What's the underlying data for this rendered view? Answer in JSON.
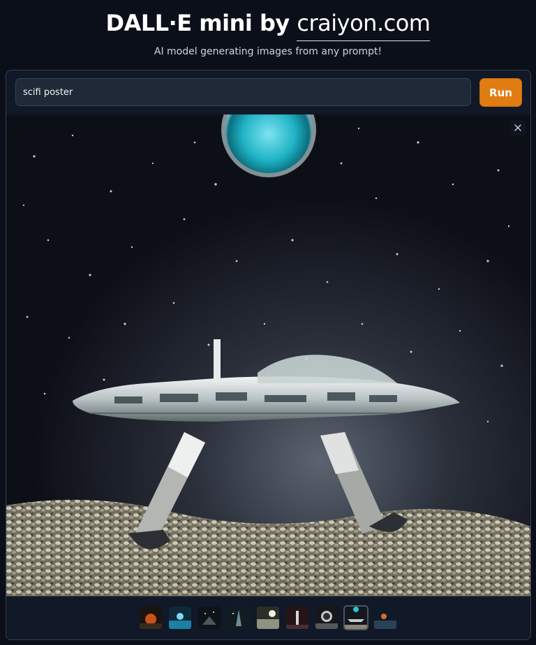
{
  "header": {
    "title_prefix": "DALL·E mini by",
    "brand_link": "craiyon.com",
    "subtitle": "AI model generating images from any prompt!"
  },
  "prompt": {
    "value": "scifi poster",
    "placeholder": ""
  },
  "run_button": {
    "label": "Run"
  },
  "gallery": {
    "selected_index": 7,
    "thumbnail_count": 9,
    "close_icon": "close-icon"
  },
  "colors": {
    "background": "#0b0f19",
    "panel": "#111827",
    "run_button": "#e07c12"
  }
}
